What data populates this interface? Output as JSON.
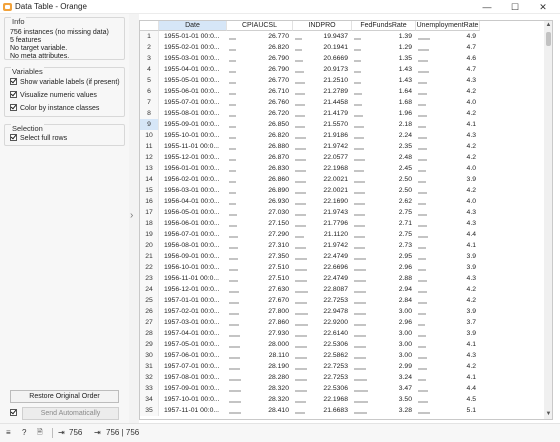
{
  "window": {
    "title": "Data Table - Orange",
    "minimize": "—",
    "maximize": "☐",
    "close": "✕"
  },
  "info": {
    "title": "Info",
    "lines": [
      "756 instances (no missing data)",
      "5 features",
      "No target variable.",
      "No meta attributes."
    ]
  },
  "variables": {
    "title": "Variables",
    "options": [
      "Show variable labels (if present)",
      "Visualize numeric values",
      "Color by instance classes"
    ]
  },
  "selection": {
    "title": "Selection",
    "options": [
      "Select full rows"
    ]
  },
  "buttons": {
    "restore": "Restore Original Order",
    "send": "Send Automatically"
  },
  "table": {
    "columns": [
      "Date",
      "CPIAUCSL",
      "INDPRO",
      "FedFundsRate",
      "UnemploymentRate"
    ],
    "selected_row": 9,
    "rows": [
      [
        "1",
        "1955-01-01 00:0...",
        "26.770",
        "19.9437",
        "1.39",
        "4.9"
      ],
      [
        "2",
        "1955-02-01 00:0...",
        "26.820",
        "20.1941",
        "1.29",
        "4.7"
      ],
      [
        "3",
        "1955-03-01 00:0...",
        "26.790",
        "20.6669",
        "1.35",
        "4.6"
      ],
      [
        "4",
        "1955-04-01 00:0...",
        "26.790",
        "20.9173",
        "1.43",
        "4.7"
      ],
      [
        "5",
        "1955-05-01 00:0...",
        "26.770",
        "21.2510",
        "1.43",
        "4.3"
      ],
      [
        "6",
        "1955-06-01 00:0...",
        "26.710",
        "21.2789",
        "1.64",
        "4.2"
      ],
      [
        "7",
        "1955-07-01 00:0...",
        "26.760",
        "21.4458",
        "1.68",
        "4.0"
      ],
      [
        "8",
        "1955-08-01 00:0...",
        "26.720",
        "21.4179",
        "1.96",
        "4.2"
      ],
      [
        "9",
        "1955-09-01 00:0...",
        "26.850",
        "21.5570",
        "2.18",
        "4.1"
      ],
      [
        "10",
        "1955-10-01 00:0...",
        "26.820",
        "21.9186",
        "2.24",
        "4.3"
      ],
      [
        "11",
        "1955-11-01 00:0...",
        "26.880",
        "21.9742",
        "2.35",
        "4.2"
      ],
      [
        "12",
        "1955-12-01 00:0...",
        "26.870",
        "22.0577",
        "2.48",
        "4.2"
      ],
      [
        "13",
        "1956-01-01 00:0...",
        "26.830",
        "22.1968",
        "2.45",
        "4.0"
      ],
      [
        "14",
        "1956-02-01 00:0...",
        "26.860",
        "22.0021",
        "2.50",
        "3.9"
      ],
      [
        "15",
        "1956-03-01 00:0...",
        "26.890",
        "22.0021",
        "2.50",
        "4.2"
      ],
      [
        "16",
        "1956-04-01 00:0...",
        "26.930",
        "22.1690",
        "2.62",
        "4.0"
      ],
      [
        "17",
        "1956-05-01 00:0...",
        "27.030",
        "21.9743",
        "2.75",
        "4.3"
      ],
      [
        "18",
        "1956-06-01 00:0...",
        "27.150",
        "21.7796",
        "2.71",
        "4.3"
      ],
      [
        "19",
        "1956-07-01 00:0...",
        "27.290",
        "21.1120",
        "2.75",
        "4.4"
      ],
      [
        "20",
        "1956-08-01 00:0...",
        "27.310",
        "21.9742",
        "2.73",
        "4.1"
      ],
      [
        "21",
        "1956-09-01 00:0...",
        "27.350",
        "22.4749",
        "2.95",
        "3.9"
      ],
      [
        "22",
        "1956-10-01 00:0...",
        "27.510",
        "22.6696",
        "2.96",
        "3.9"
      ],
      [
        "23",
        "1956-11-01 00:0...",
        "27.510",
        "22.4749",
        "2.88",
        "4.3"
      ],
      [
        "24",
        "1956-12-01 00:0...",
        "27.630",
        "22.8087",
        "2.94",
        "4.2"
      ],
      [
        "25",
        "1957-01-01 00:0...",
        "27.670",
        "22.7253",
        "2.84",
        "4.2"
      ],
      [
        "26",
        "1957-02-01 00:0...",
        "27.800",
        "22.9478",
        "3.00",
        "3.9"
      ],
      [
        "27",
        "1957-03-01 00:0...",
        "27.860",
        "22.9200",
        "2.96",
        "3.7"
      ],
      [
        "28",
        "1957-04-01 00:0...",
        "27.930",
        "22.6140",
        "3.00",
        "3.9"
      ],
      [
        "29",
        "1957-05-01 00:0...",
        "28.000",
        "22.5306",
        "3.00",
        "4.1"
      ],
      [
        "30",
        "1957-06-01 00:0...",
        "28.110",
        "22.5862",
        "3.00",
        "4.3"
      ],
      [
        "31",
        "1957-07-01 00:0...",
        "28.190",
        "22.7253",
        "2.99",
        "4.2"
      ],
      [
        "32",
        "1957-08-01 00:0...",
        "28.280",
        "22.7253",
        "3.24",
        "4.1"
      ],
      [
        "33",
        "1957-09-01 00:0...",
        "28.320",
        "22.5306",
        "3.47",
        "4.4"
      ],
      [
        "34",
        "1957-10-01 00:0...",
        "28.320",
        "22.1968",
        "3.50",
        "4.5"
      ],
      [
        "35",
        "1957-11-01 00:0...",
        "28.410",
        "21.6683",
        "3.28",
        "5.1"
      ]
    ]
  },
  "status": {
    "menu_icon": "≡",
    "help_icon": "?",
    "doc_icon": "🗎",
    "input_count": "756",
    "output_count": "756 | 756"
  }
}
